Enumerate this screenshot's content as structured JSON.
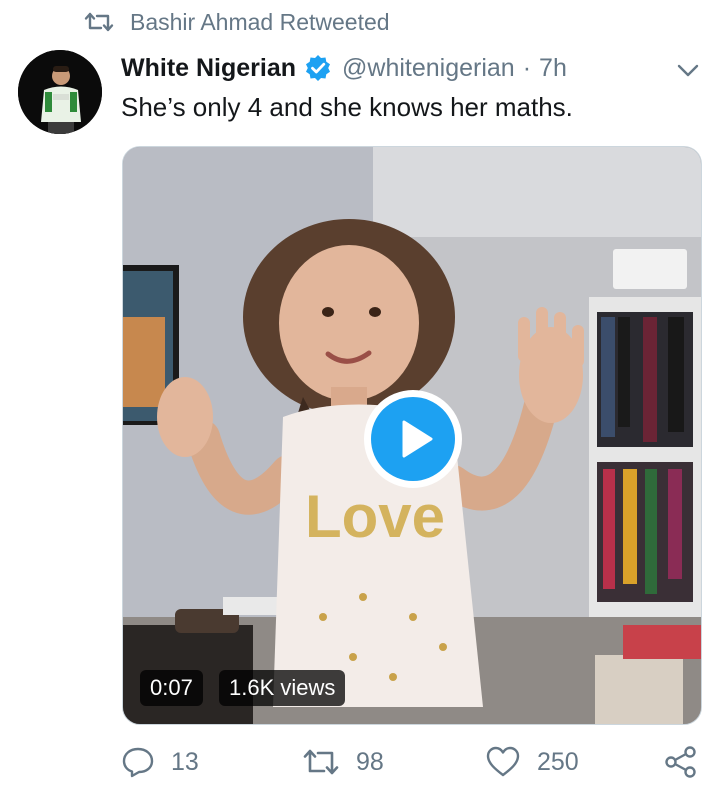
{
  "retweet_context": {
    "text": "Bashir Ahmad Retweeted",
    "icon": "retweet-icon"
  },
  "tweet": {
    "author_name": "White Nigerian",
    "verified": true,
    "handle": "@whitenigerian",
    "separator": "·",
    "time": "7h",
    "text": "She’s only 4 and she knows her maths."
  },
  "media": {
    "type": "video",
    "duration": "0:07",
    "views": "1.6K views",
    "play_button_color": "#1da1f2",
    "shirt_print": "Love"
  },
  "actions": {
    "reply_count": "13",
    "retweet_count": "98",
    "like_count": "250"
  },
  "colors": {
    "accent": "#1da1f2",
    "muted_text": "#657786",
    "primary_text": "#14171a"
  }
}
